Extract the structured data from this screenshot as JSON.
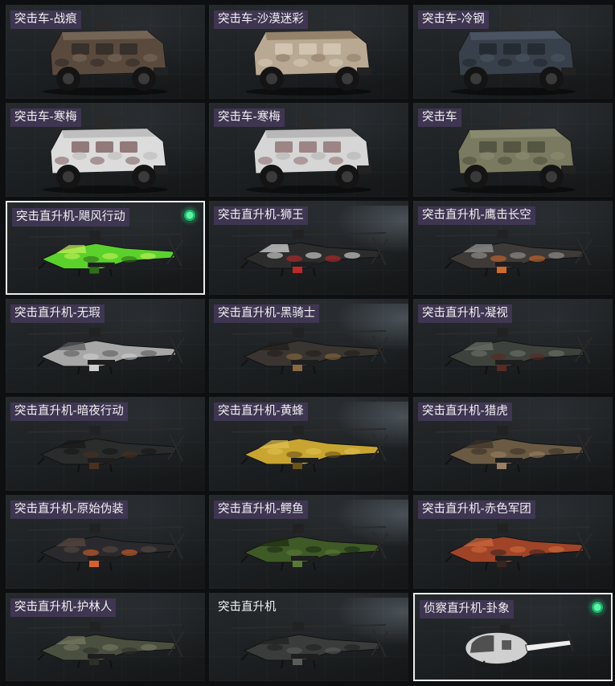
{
  "tiles": [
    {
      "label": "突击车-战痕",
      "kind": "truck",
      "colors": [
        "#5a4a3e",
        "#7b6a5c",
        "#2e2824"
      ],
      "selected": false
    },
    {
      "label": "突击车-沙漠迷彩",
      "kind": "truck",
      "colors": [
        "#b9a892",
        "#8b7862",
        "#d9cdb9"
      ],
      "selected": false
    },
    {
      "label": "突击车-冷钢",
      "kind": "truck",
      "colors": [
        "#38404b",
        "#4d5866",
        "#1f242a"
      ],
      "selected": false
    },
    {
      "label": "突击车-寒梅",
      "kind": "truck",
      "colors": [
        "#dcdcdc",
        "#b8b8b8",
        "#7a5a5a"
      ],
      "selected": false
    },
    {
      "label": "突击车-寒梅",
      "kind": "truck",
      "colors": [
        "#d6d6d6",
        "#b0b0b0",
        "#8a6a6a"
      ],
      "selected": false
    },
    {
      "label": "突击车",
      "kind": "truck",
      "colors": [
        "#7a7a60",
        "#8e8e74",
        "#4a4a3a"
      ],
      "selected": false
    },
    {
      "label": "突击直升机-飓风行动",
      "kind": "heli",
      "colors": [
        "#5bd22c",
        "#2f6e1a",
        "#c8f05a"
      ],
      "selected": true,
      "owned": true
    },
    {
      "label": "突击直升机-狮王",
      "kind": "heli",
      "colors": [
        "#2c2c2c",
        "#c02828",
        "#e0e0e0"
      ],
      "selected": false
    },
    {
      "label": "突击直升机-鹰击长空",
      "kind": "heli",
      "colors": [
        "#3e3a38",
        "#d06a2a",
        "#9a9a9a"
      ],
      "selected": false
    },
    {
      "label": "突击直升机-无瑕",
      "kind": "heli",
      "colors": [
        "#a7a7a7",
        "#cfcfcf",
        "#5a5a5a"
      ],
      "selected": false
    },
    {
      "label": "突击直升机-黑骑士",
      "kind": "heli",
      "colors": [
        "#3a3530",
        "#8a6a40",
        "#1e1c1a"
      ],
      "selected": false
    },
    {
      "label": "突击直升机-凝视",
      "kind": "heli",
      "colors": [
        "#3e423c",
        "#5a2a22",
        "#6e746a"
      ],
      "selected": false
    },
    {
      "label": "突击直升机-暗夜行动",
      "kind": "heli",
      "colors": [
        "#2a2c2c",
        "#4a3020",
        "#151616"
      ],
      "selected": false
    },
    {
      "label": "突击直升机-黄蜂",
      "kind": "heli",
      "colors": [
        "#c8a530",
        "#6a5418",
        "#e0c050"
      ],
      "selected": false
    },
    {
      "label": "突击直升机-猎虎",
      "kind": "heli",
      "colors": [
        "#6a5a44",
        "#9a8060",
        "#3a3026"
      ],
      "selected": false
    },
    {
      "label": "突击直升机-原始伪装",
      "kind": "heli",
      "colors": [
        "#2a2a2e",
        "#d8602a",
        "#5a4a40"
      ],
      "selected": false
    },
    {
      "label": "突击直升机-鳄鱼",
      "kind": "heli",
      "colors": [
        "#3e5a26",
        "#5a7a34",
        "#1e2a14"
      ],
      "selected": false
    },
    {
      "label": "突击直升机-赤色军团",
      "kind": "heli",
      "colors": [
        "#a04428",
        "#3a2420",
        "#d06a3a"
      ],
      "selected": false
    },
    {
      "label": "突击直升机-护林人",
      "kind": "heli",
      "colors": [
        "#4a5040",
        "#2e3028",
        "#7a7a64"
      ],
      "selected": false
    },
    {
      "label": "突击直升机",
      "kind": "heli",
      "colors": [
        "#3a3c3c",
        "#5a5c5c",
        "#1e1f1f"
      ],
      "selected": false,
      "plain": true
    },
    {
      "label": "侦察直升机-卦象",
      "kind": "scout",
      "colors": [
        "#d0d0d0",
        "#3a3a3a",
        "#eeeeee"
      ],
      "selected": true,
      "owned": true
    }
  ]
}
